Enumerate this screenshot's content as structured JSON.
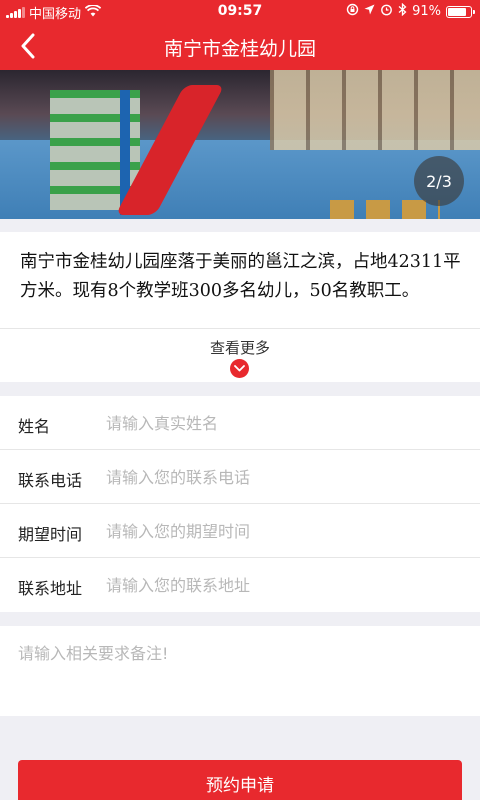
{
  "status_bar": {
    "carrier": "中国移动",
    "time": "09:57",
    "battery_text": "91%",
    "battery_level": 0.91,
    "icons": [
      "signal-icon",
      "wifi-icon",
      "rotation-lock-icon",
      "location-icon",
      "alarm-icon",
      "bluetooth-icon",
      "battery-icon"
    ]
  },
  "nav": {
    "title": "南宁市金桂幼儿园",
    "back_icon": "chevron-left-icon"
  },
  "banner": {
    "page_counter": "2/3"
  },
  "description": {
    "text": "南宁市金桂幼儿园座落于美丽的邕江之滨，占地42311平方米。现有8个教学班300多名幼儿，50名教职工。",
    "more_label": "查看更多",
    "more_icon": "chevron-down-icon"
  },
  "form": {
    "fields": [
      {
        "label": "姓名",
        "placeholder": "请输入真实姓名",
        "value": ""
      },
      {
        "label": "联系电话",
        "placeholder": "请输入您的联系电话",
        "value": ""
      },
      {
        "label": "期望时间",
        "placeholder": "请输入您的期望时间",
        "value": ""
      },
      {
        "label": "联系地址",
        "placeholder": "请输入您的联系地址",
        "value": ""
      }
    ],
    "notes_placeholder": "请输入相关要求备注!",
    "submit_label": "预约申请"
  },
  "colors": {
    "brand": "#e8292e",
    "background": "#efeff4",
    "placeholder": "#b8b8b8"
  }
}
